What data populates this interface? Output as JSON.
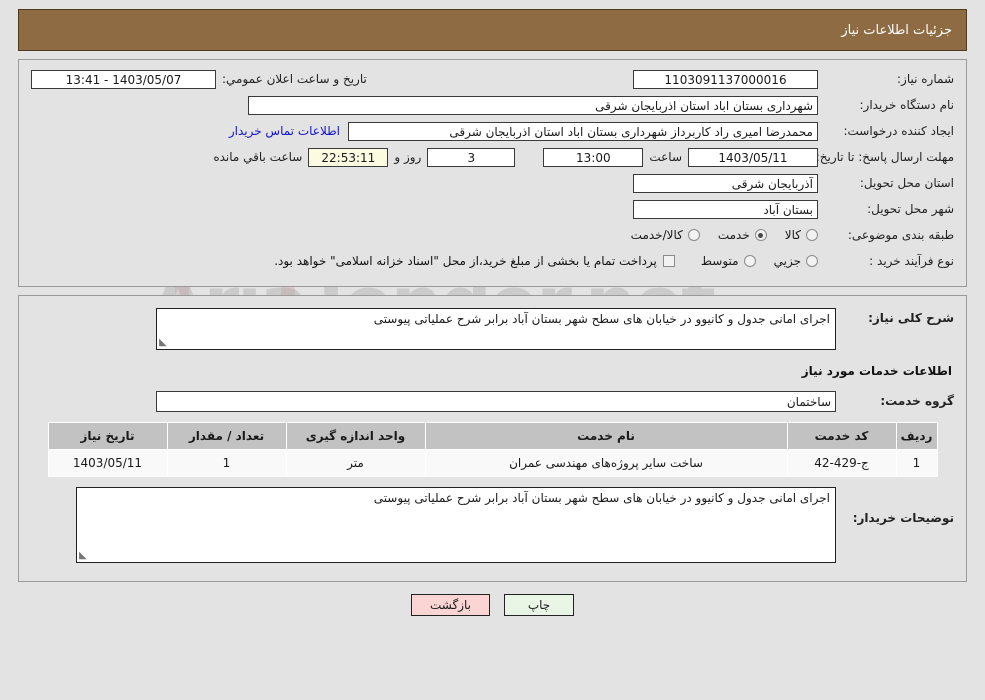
{
  "header": {
    "title": "جزئیات اطلاعات نیاز"
  },
  "colors": {
    "header_bg": "#8e6b43",
    "page_bg": "#e3e3e3",
    "link": "#1414cf",
    "back_button": "#fbd4d4",
    "print_button": "#e9f6e6",
    "timer_field": "#fbfbe2",
    "table_header": "#c2c2c2"
  },
  "top": {
    "need_number_label": "شماره نیاز:",
    "need_number_value": "1103091137000016",
    "announce_label": "تاریخ و ساعت اعلان عمومي:",
    "announce_value": "1403/05/07 - 13:41",
    "buyer_org_label": "نام دستگاه خریدار:",
    "buyer_org_value": "شهرداری بستان اباد استان اذربایجان شرقی",
    "creator_label": "ایجاد کننده درخواست:",
    "creator_value": "محمدرضا امیری راد کاربرداز شهرداری بستان اباد استان اذربایجان شرقی",
    "contact_link": "اطلاعات تماس خریدار",
    "deadline_label": "مهلت ارسال پاسخ: تا تاریخ:",
    "deadline_date": "1403/05/11",
    "hour_label": "ساعت",
    "deadline_time": "13:00",
    "days_value": "3",
    "days_label": "روز و",
    "timer_value": "22:53:11",
    "remaining_label": "ساعت باقي مانده",
    "province_label": "استان محل تحویل:",
    "province_value": "آذربایجان شرقی",
    "city_label": "شهر محل تحویل:",
    "city_value": "بستان آباد",
    "category_label": "طبقه بندی موضوعی:",
    "category_options": [
      {
        "label": "کالا",
        "selected": false
      },
      {
        "label": "خدمت",
        "selected": true
      },
      {
        "label": "کالا/خدمت",
        "selected": false
      }
    ],
    "process_label": "نوع فرآیند خرید :",
    "process_options": [
      {
        "label": "جزیي",
        "selected": false
      },
      {
        "label": "متوسط",
        "selected": false
      }
    ],
    "treasury_checked": false,
    "treasury_note": "پرداخت تمام یا بخشی از مبلغ خرید،از محل \"اسناد خزانه اسلامی\" خواهد بود."
  },
  "middle": {
    "general_desc_label": "شرح کلی نیاز:",
    "general_desc_value": "اجرای امانی جدول و کانیوو در خیابان های سطح شهر بستان آباد برابر شرح عملیاتی پیوستی",
    "services_section_title": "اطلاعات خدمات مورد نیاز",
    "service_group_label": "گروه خدمت:",
    "service_group_value": "ساختمان"
  },
  "table": {
    "columns": [
      "ردیف",
      "کد خدمت",
      "نام خدمت",
      "واحد اندازه گیری",
      "تعداد / مقدار",
      "تاریخ نیاز"
    ],
    "rows": [
      {
        "row": "1",
        "code": "ج-429-42",
        "name": "ساخت سایر پروژه‌های مهندسی عمران",
        "unit": "متر",
        "qty": "1",
        "date": "1403/05/11"
      }
    ]
  },
  "buyer_notes": {
    "label": "توضیحات خریدار:",
    "value": "اجرای امانی جدول و کانیوو در خیابان های سطح شهر بستان آباد برابر شرح عملیاتی پیوستی"
  },
  "footer": {
    "print_label": "چاپ",
    "back_label": "بازگشت"
  }
}
